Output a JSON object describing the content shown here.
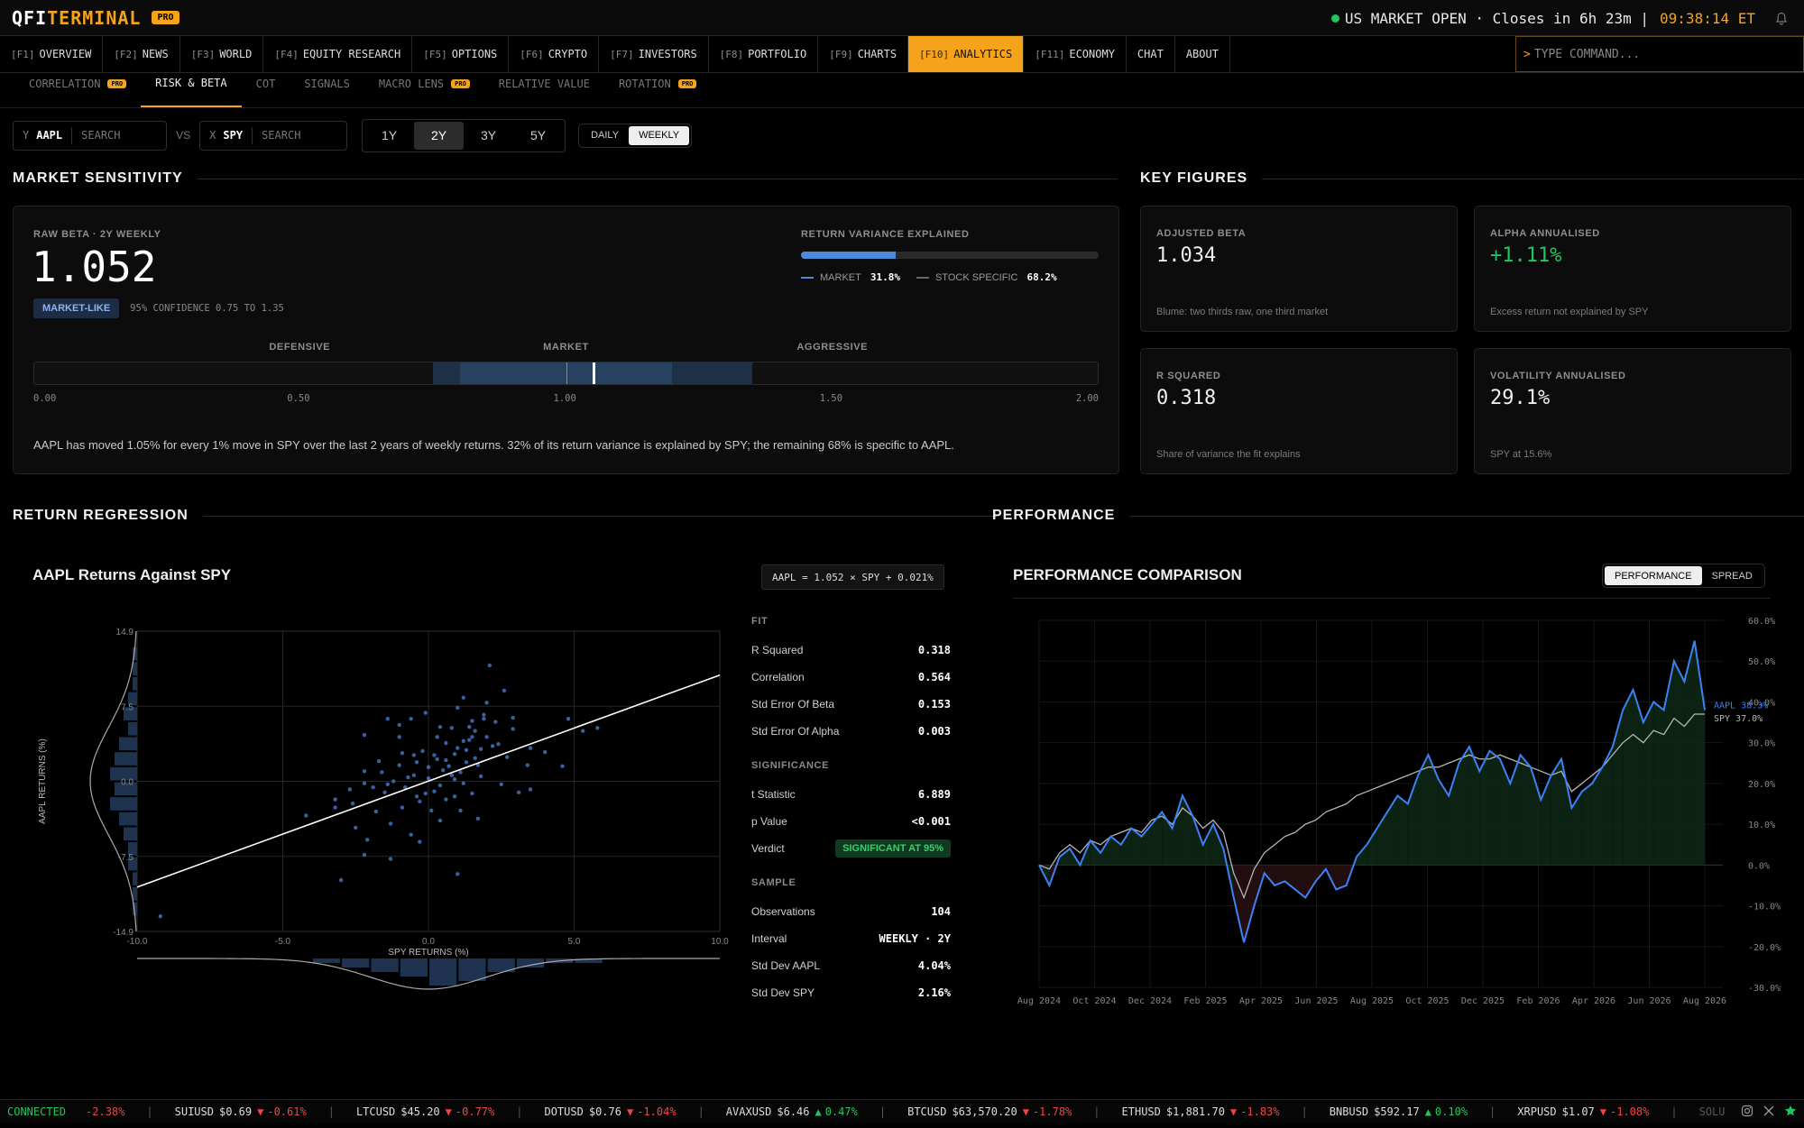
{
  "app": {
    "logo_a": "QFI",
    "logo_b": "TERMINAL",
    "badge": "PRO"
  },
  "status": {
    "market": "US MARKET OPEN",
    "closes": "· Closes in 6h 23m",
    "sep": "|",
    "clock": "09:38:14 ET"
  },
  "nav": [
    {
      "key": "[F1]",
      "label": "OVERVIEW"
    },
    {
      "key": "[F2]",
      "label": "NEWS"
    },
    {
      "key": "[F3]",
      "label": "WORLD"
    },
    {
      "key": "[F4]",
      "label": "EQUITY RESEARCH"
    },
    {
      "key": "[F5]",
      "label": "OPTIONS"
    },
    {
      "key": "[F6]",
      "label": "CRYPTO"
    },
    {
      "key": "[F7]",
      "label": "INVESTORS"
    },
    {
      "key": "[F8]",
      "label": "PORTFOLIO"
    },
    {
      "key": "[F9]",
      "label": "CHARTS"
    },
    {
      "key": "[F10]",
      "label": "ANALYTICS"
    },
    {
      "key": "[F11]",
      "label": "ECONOMY"
    },
    {
      "key": "",
      "label": "CHAT"
    },
    {
      "key": "",
      "label": "ABOUT"
    }
  ],
  "command": {
    "prompt": ">",
    "placeholder": "TYPE COMMAND..."
  },
  "subnav": [
    {
      "label": "CORRELATION",
      "pro": "PRO"
    },
    {
      "label": "RISK & BETA",
      "pro": ""
    },
    {
      "label": "COT",
      "pro": ""
    },
    {
      "label": "SIGNALS",
      "pro": ""
    },
    {
      "label": "MACRO LENS",
      "pro": "PRO"
    },
    {
      "label": "RELATIVE VALUE",
      "pro": ""
    },
    {
      "label": "ROTATION",
      "pro": "PRO"
    }
  ],
  "controls": {
    "y_axis": "Y",
    "y_symbol": "AAPL",
    "x_axis": "X",
    "x_symbol": "SPY",
    "search": "SEARCH",
    "vs": "VS",
    "periods": [
      "1Y",
      "2Y",
      "3Y",
      "5Y"
    ],
    "period_selected": "2Y",
    "intervals": [
      "DAILY",
      "WEEKLY"
    ],
    "interval_selected": "WEEKLY"
  },
  "sensitivity": {
    "title": "MARKET SENSITIVITY",
    "raw_label": "RAW BETA · 2Y WEEKLY",
    "beta": "1.052",
    "class_badge": "MARKET-LIKE",
    "confidence": "95% CONFIDENCE 0.75 TO 1.35",
    "variance_label": "RETURN VARIANCE EXPLAINED",
    "variance_market_fraction": 0.318,
    "market_label": "MARKET",
    "market_pct": "31.8%",
    "specific_label": "STOCK SPECIFIC",
    "specific_pct": "68.2%",
    "zones": [
      "DEFENSIVE",
      "MARKET",
      "AGGRESSIVE"
    ],
    "scale": [
      "0.00",
      "0.50",
      "1.00",
      "1.50",
      "2.00"
    ],
    "gauge_beta": 1.052,
    "ci": [
      0.75,
      1.35
    ],
    "summary": "AAPL has moved 1.05% for every 1% move in SPY over the last 2 years of weekly returns. 32% of its return variance is explained by SPY; the remaining 68% is specific to AAPL."
  },
  "key_figures": {
    "title": "KEY FIGURES",
    "cards": [
      {
        "label": "ADJUSTED BETA",
        "value": "1.034",
        "note": "Blume: two thirds raw, one third market",
        "color": "#eeeeee"
      },
      {
        "label": "ALPHA ANNUALISED",
        "value": "+1.11%",
        "note": "Excess return not explained by SPY",
        "color": "#22c55e"
      },
      {
        "label": "R SQUARED",
        "value": "0.318",
        "note": "Share of variance the fit explains",
        "color": "#eeeeee"
      },
      {
        "label": "VOLATILITY ANNUALISED",
        "value": "29.1%",
        "note": "SPY at 15.6%",
        "color": "#eeeeee"
      }
    ]
  },
  "regression": {
    "section": "RETURN REGRESSION",
    "title": "AAPL Returns Against SPY",
    "equation": "AAPL = 1.052 × SPY + 0.021%",
    "fit_h": "FIT",
    "fit": [
      {
        "k": "R Squared",
        "v": "0.318"
      },
      {
        "k": "Correlation",
        "v": "0.564"
      },
      {
        "k": "Std Error Of Beta",
        "v": "0.153"
      },
      {
        "k": "Std Error Of Alpha",
        "v": "0.003"
      }
    ],
    "sig_h": "SIGNIFICANCE",
    "sig": [
      {
        "k": "t Statistic",
        "v": "6.889"
      },
      {
        "k": "p Value",
        "v": "<0.001"
      }
    ],
    "verdict_k": "Verdict",
    "verdict_v": "SIGNIFICANT AT 95%",
    "sample_h": "SAMPLE",
    "sample": [
      {
        "k": "Observations",
        "v": "104"
      },
      {
        "k": "Interval",
        "v": "WEEKLY · 2Y"
      },
      {
        "k": "Std Dev AAPL",
        "v": "4.04%"
      },
      {
        "k": "Std Dev SPY",
        "v": "2.16%"
      }
    ]
  },
  "performance": {
    "section": "PERFORMANCE",
    "title": "PERFORMANCE COMPARISON",
    "toggle": [
      "PERFORMANCE",
      "SPREAD"
    ],
    "toggle_selected": "PERFORMANCE"
  },
  "chart_data": [
    {
      "type": "scatter",
      "xlabel": "SPY RETURNS (%)",
      "ylabel": "AAPL RETURNS (%)",
      "xlim": [
        -10,
        10
      ],
      "ylim": [
        -14.9,
        14.9
      ],
      "xticks": [
        "-10.0",
        "-5.0",
        "0.0",
        "5.0",
        "10.0"
      ],
      "yticks": [
        "14.9",
        "7.5",
        "0.0",
        "-7.5",
        "-14.9"
      ],
      "fit": {
        "slope": 1.052,
        "intercept": 0.021
      },
      "color": "#4a78c8",
      "points": [
        [
          -9.2,
          -13.4
        ],
        [
          -3.0,
          -9.8
        ],
        [
          1.0,
          -9.2
        ],
        [
          -2.2,
          -7.3
        ],
        [
          -1.3,
          -7.7
        ],
        [
          -4.2,
          -3.4
        ],
        [
          -2.5,
          -4.6
        ],
        [
          -2.1,
          -5.8
        ],
        [
          -1.8,
          -3.0
        ],
        [
          -0.6,
          -5.3
        ],
        [
          -0.3,
          -6.0
        ],
        [
          0.4,
          -3.9
        ],
        [
          1.7,
          -3.7
        ],
        [
          -1.5,
          -1.1
        ],
        [
          -0.9,
          -2.6
        ],
        [
          -0.3,
          -2.0
        ],
        [
          0.1,
          -2.9
        ],
        [
          0.6,
          -1.8
        ],
        [
          0.2,
          -1.0
        ],
        [
          0.9,
          -1.5
        ],
        [
          1.5,
          -1.2
        ],
        [
          -3.2,
          -1.8
        ],
        [
          -2.7,
          -0.8
        ],
        [
          -1.2,
          0.0
        ],
        [
          -0.8,
          -0.6
        ],
        [
          0.0,
          0.3
        ],
        [
          0.4,
          -0.4
        ],
        [
          0.9,
          0.2
        ],
        [
          1.2,
          -0.2
        ],
        [
          1.8,
          0.5
        ],
        [
          -2.2,
          1.0
        ],
        [
          -1.6,
          0.9
        ],
        [
          -1.0,
          1.6
        ],
        [
          -0.4,
          1.9
        ],
        [
          0.2,
          2.6
        ],
        [
          0.6,
          2.1
        ],
        [
          0.9,
          2.7
        ],
        [
          1.3,
          1.9
        ],
        [
          1.6,
          2.3
        ],
        [
          1.0,
          3.3
        ],
        [
          1.4,
          4.1
        ],
        [
          0.3,
          4.4
        ],
        [
          -0.5,
          2.6
        ],
        [
          -1.7,
          2.0
        ],
        [
          2.2,
          3.5
        ],
        [
          3.4,
          1.6
        ],
        [
          3.5,
          3.3
        ],
        [
          4.0,
          2.9
        ],
        [
          4.6,
          1.5
        ],
        [
          3.5,
          -0.8
        ],
        [
          1.5,
          4.4
        ],
        [
          -2.2,
          4.6
        ],
        [
          -1.4,
          6.2
        ],
        [
          -1.0,
          5.6
        ],
        [
          -0.6,
          6.2
        ],
        [
          -0.1,
          6.8
        ],
        [
          1.0,
          7.3
        ],
        [
          1.4,
          5.4
        ],
        [
          1.5,
          6.0
        ],
        [
          1.9,
          6.6
        ],
        [
          2.0,
          7.8
        ],
        [
          2.9,
          5.2
        ],
        [
          2.4,
          3.7
        ],
        [
          1.2,
          8.3
        ],
        [
          2.6,
          9.0
        ],
        [
          2.1,
          11.5
        ],
        [
          5.3,
          5.0
        ],
        [
          5.8,
          5.3
        ],
        [
          1.6,
          5.0
        ],
        [
          0.4,
          5.4
        ],
        [
          2.9,
          6.3
        ],
        [
          -1.0,
          4.4
        ],
        [
          0.8,
          5.3
        ],
        [
          2.0,
          4.4
        ],
        [
          0.0,
          1.4
        ],
        [
          -0.7,
          0.4
        ],
        [
          0.7,
          1.5
        ],
        [
          1.1,
          0.9
        ],
        [
          -1.4,
          -0.3
        ],
        [
          -3.2,
          -2.6
        ],
        [
          -0.1,
          -1.2
        ],
        [
          1.1,
          -2.9
        ],
        [
          4.8,
          6.2
        ],
        [
          1.7,
          1.6
        ],
        [
          2.5,
          -0.3
        ],
        [
          1.9,
          6.2
        ],
        [
          -0.9,
          2.8
        ],
        [
          3.1,
          -1.1
        ],
        [
          -1.3,
          -4.2
        ],
        [
          0.8,
          0.6
        ],
        [
          -2.2,
          -0.2
        ],
        [
          1.3,
          3.1
        ],
        [
          0.3,
          2.2
        ],
        [
          -0.4,
          -1.5
        ],
        [
          2.7,
          2.4
        ],
        [
          0.6,
          3.8
        ],
        [
          -0.2,
          3.0
        ],
        [
          1.8,
          3.2
        ],
        [
          -1.9,
          -0.6
        ],
        [
          0.5,
          1.1
        ],
        [
          -0.5,
          0.6
        ],
        [
          1.2,
          4.0
        ],
        [
          2.3,
          5.9
        ],
        [
          -2.6,
          -2.2
        ]
      ]
    },
    {
      "type": "line",
      "x_ticks": [
        "Aug 2024",
        "Oct 2024",
        "Dec 2024",
        "Feb 2025",
        "Apr 2025",
        "Jun 2025",
        "Aug 2025",
        "Oct 2025",
        "Dec 2025",
        "Feb 2026",
        "Apr 2026",
        "Jun 2026",
        "Aug 2026"
      ],
      "ylim": [
        -30,
        60
      ],
      "y_ticks": [
        "60.0%",
        "50.0%",
        "40.0%",
        "30.0%",
        "20.0%",
        "10.0%",
        "0.0%",
        "-10.0%",
        "-20.0%",
        "-30.0%"
      ],
      "series": [
        {
          "name": "AAPL",
          "end_label": "AAPL 38.3%",
          "color": "#3b82f6",
          "values": [
            0,
            -5,
            2,
            4,
            0,
            6,
            3,
            7,
            5,
            9,
            7,
            10,
            13,
            9,
            17,
            12,
            5,
            10,
            4,
            -8,
            -19,
            -10,
            -2,
            -5,
            -4,
            -6,
            -8,
            -4,
            -1,
            -6,
            -5,
            2,
            5,
            9,
            13,
            17,
            15,
            22,
            27,
            21,
            17,
            25,
            29,
            23,
            28,
            26,
            20,
            27,
            24,
            16,
            22,
            26,
            14,
            18,
            20,
            24,
            29,
            38,
            43,
            35,
            40,
            38,
            50,
            45,
            55,
            38
          ]
        },
        {
          "name": "SPY",
          "end_label": "SPY 37.0%",
          "color": "#b5b5b5",
          "values": [
            0,
            -1,
            3,
            5,
            3,
            6,
            5,
            7,
            8,
            9,
            8,
            11,
            12,
            10,
            14,
            12,
            9,
            11,
            8,
            -2,
            -8,
            -1,
            3,
            5,
            7,
            8,
            10,
            11,
            13,
            14,
            15,
            17,
            18,
            19,
            20,
            21,
            22,
            23,
            24,
            24,
            25,
            26,
            27,
            26,
            26,
            27,
            26,
            25,
            24,
            23,
            22,
            23,
            18,
            20,
            22,
            24,
            27,
            30,
            32,
            30,
            33,
            32,
            36,
            34,
            37,
            37
          ]
        }
      ]
    }
  ],
  "ticker": {
    "connected": "CONNECTED",
    "lead_pct": "-2.38%",
    "items": [
      {
        "sym": "SUIUSD",
        "px": "$0.69",
        "dir": "down",
        "chg": "-0.61%"
      },
      {
        "sym": "LTCUSD",
        "px": "$45.20",
        "dir": "down",
        "chg": "-0.77%"
      },
      {
        "sym": "DOTUSD",
        "px": "$0.76",
        "dir": "down",
        "chg": "-1.04%"
      },
      {
        "sym": "AVAXUSD",
        "px": "$6.46",
        "dir": "up",
        "chg": "0.47%"
      },
      {
        "sym": "BTCUSD",
        "px": "$63,570.20",
        "dir": "down",
        "chg": "-1.78%"
      },
      {
        "sym": "ETHUSD",
        "px": "$1,881.70",
        "dir": "down",
        "chg": "-1.83%"
      },
      {
        "sym": "BNBUSD",
        "px": "$592.17",
        "dir": "up",
        "chg": "0.10%"
      },
      {
        "sym": "XRPUSD",
        "px": "$1.07",
        "dir": "down",
        "chg": "-1.08%"
      }
    ],
    "trailing": "SOLU"
  }
}
